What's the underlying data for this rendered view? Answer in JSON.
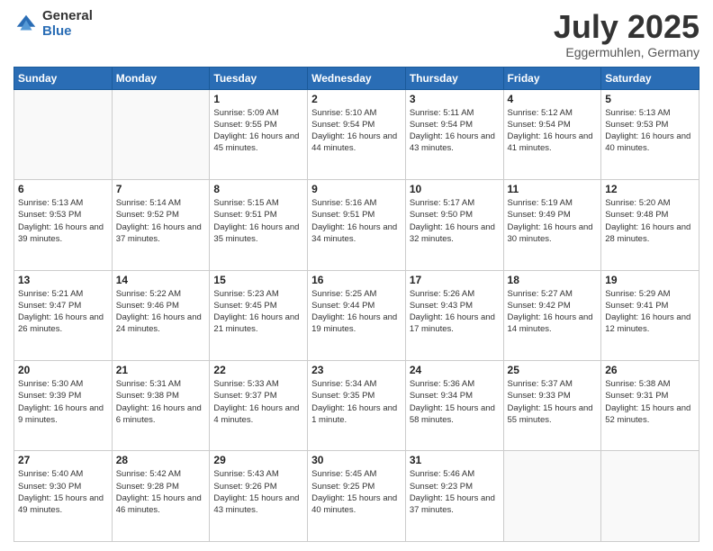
{
  "logo": {
    "general": "General",
    "blue": "Blue"
  },
  "title": "July 2025",
  "subtitle": "Eggermuhlen, Germany",
  "days_of_week": [
    "Sunday",
    "Monday",
    "Tuesday",
    "Wednesday",
    "Thursday",
    "Friday",
    "Saturday"
  ],
  "weeks": [
    [
      {
        "day": "",
        "info": ""
      },
      {
        "day": "",
        "info": ""
      },
      {
        "day": "1",
        "info": "Sunrise: 5:09 AM\nSunset: 9:55 PM\nDaylight: 16 hours and 45 minutes."
      },
      {
        "day": "2",
        "info": "Sunrise: 5:10 AM\nSunset: 9:54 PM\nDaylight: 16 hours and 44 minutes."
      },
      {
        "day": "3",
        "info": "Sunrise: 5:11 AM\nSunset: 9:54 PM\nDaylight: 16 hours and 43 minutes."
      },
      {
        "day": "4",
        "info": "Sunrise: 5:12 AM\nSunset: 9:54 PM\nDaylight: 16 hours and 41 minutes."
      },
      {
        "day": "5",
        "info": "Sunrise: 5:13 AM\nSunset: 9:53 PM\nDaylight: 16 hours and 40 minutes."
      }
    ],
    [
      {
        "day": "6",
        "info": "Sunrise: 5:13 AM\nSunset: 9:53 PM\nDaylight: 16 hours and 39 minutes."
      },
      {
        "day": "7",
        "info": "Sunrise: 5:14 AM\nSunset: 9:52 PM\nDaylight: 16 hours and 37 minutes."
      },
      {
        "day": "8",
        "info": "Sunrise: 5:15 AM\nSunset: 9:51 PM\nDaylight: 16 hours and 35 minutes."
      },
      {
        "day": "9",
        "info": "Sunrise: 5:16 AM\nSunset: 9:51 PM\nDaylight: 16 hours and 34 minutes."
      },
      {
        "day": "10",
        "info": "Sunrise: 5:17 AM\nSunset: 9:50 PM\nDaylight: 16 hours and 32 minutes."
      },
      {
        "day": "11",
        "info": "Sunrise: 5:19 AM\nSunset: 9:49 PM\nDaylight: 16 hours and 30 minutes."
      },
      {
        "day": "12",
        "info": "Sunrise: 5:20 AM\nSunset: 9:48 PM\nDaylight: 16 hours and 28 minutes."
      }
    ],
    [
      {
        "day": "13",
        "info": "Sunrise: 5:21 AM\nSunset: 9:47 PM\nDaylight: 16 hours and 26 minutes."
      },
      {
        "day": "14",
        "info": "Sunrise: 5:22 AM\nSunset: 9:46 PM\nDaylight: 16 hours and 24 minutes."
      },
      {
        "day": "15",
        "info": "Sunrise: 5:23 AM\nSunset: 9:45 PM\nDaylight: 16 hours and 21 minutes."
      },
      {
        "day": "16",
        "info": "Sunrise: 5:25 AM\nSunset: 9:44 PM\nDaylight: 16 hours and 19 minutes."
      },
      {
        "day": "17",
        "info": "Sunrise: 5:26 AM\nSunset: 9:43 PM\nDaylight: 16 hours and 17 minutes."
      },
      {
        "day": "18",
        "info": "Sunrise: 5:27 AM\nSunset: 9:42 PM\nDaylight: 16 hours and 14 minutes."
      },
      {
        "day": "19",
        "info": "Sunrise: 5:29 AM\nSunset: 9:41 PM\nDaylight: 16 hours and 12 minutes."
      }
    ],
    [
      {
        "day": "20",
        "info": "Sunrise: 5:30 AM\nSunset: 9:39 PM\nDaylight: 16 hours and 9 minutes."
      },
      {
        "day": "21",
        "info": "Sunrise: 5:31 AM\nSunset: 9:38 PM\nDaylight: 16 hours and 6 minutes."
      },
      {
        "day": "22",
        "info": "Sunrise: 5:33 AM\nSunset: 9:37 PM\nDaylight: 16 hours and 4 minutes."
      },
      {
        "day": "23",
        "info": "Sunrise: 5:34 AM\nSunset: 9:35 PM\nDaylight: 16 hours and 1 minute."
      },
      {
        "day": "24",
        "info": "Sunrise: 5:36 AM\nSunset: 9:34 PM\nDaylight: 15 hours and 58 minutes."
      },
      {
        "day": "25",
        "info": "Sunrise: 5:37 AM\nSunset: 9:33 PM\nDaylight: 15 hours and 55 minutes."
      },
      {
        "day": "26",
        "info": "Sunrise: 5:38 AM\nSunset: 9:31 PM\nDaylight: 15 hours and 52 minutes."
      }
    ],
    [
      {
        "day": "27",
        "info": "Sunrise: 5:40 AM\nSunset: 9:30 PM\nDaylight: 15 hours and 49 minutes."
      },
      {
        "day": "28",
        "info": "Sunrise: 5:42 AM\nSunset: 9:28 PM\nDaylight: 15 hours and 46 minutes."
      },
      {
        "day": "29",
        "info": "Sunrise: 5:43 AM\nSunset: 9:26 PM\nDaylight: 15 hours and 43 minutes."
      },
      {
        "day": "30",
        "info": "Sunrise: 5:45 AM\nSunset: 9:25 PM\nDaylight: 15 hours and 40 minutes."
      },
      {
        "day": "31",
        "info": "Sunrise: 5:46 AM\nSunset: 9:23 PM\nDaylight: 15 hours and 37 minutes."
      },
      {
        "day": "",
        "info": ""
      },
      {
        "day": "",
        "info": ""
      }
    ]
  ]
}
